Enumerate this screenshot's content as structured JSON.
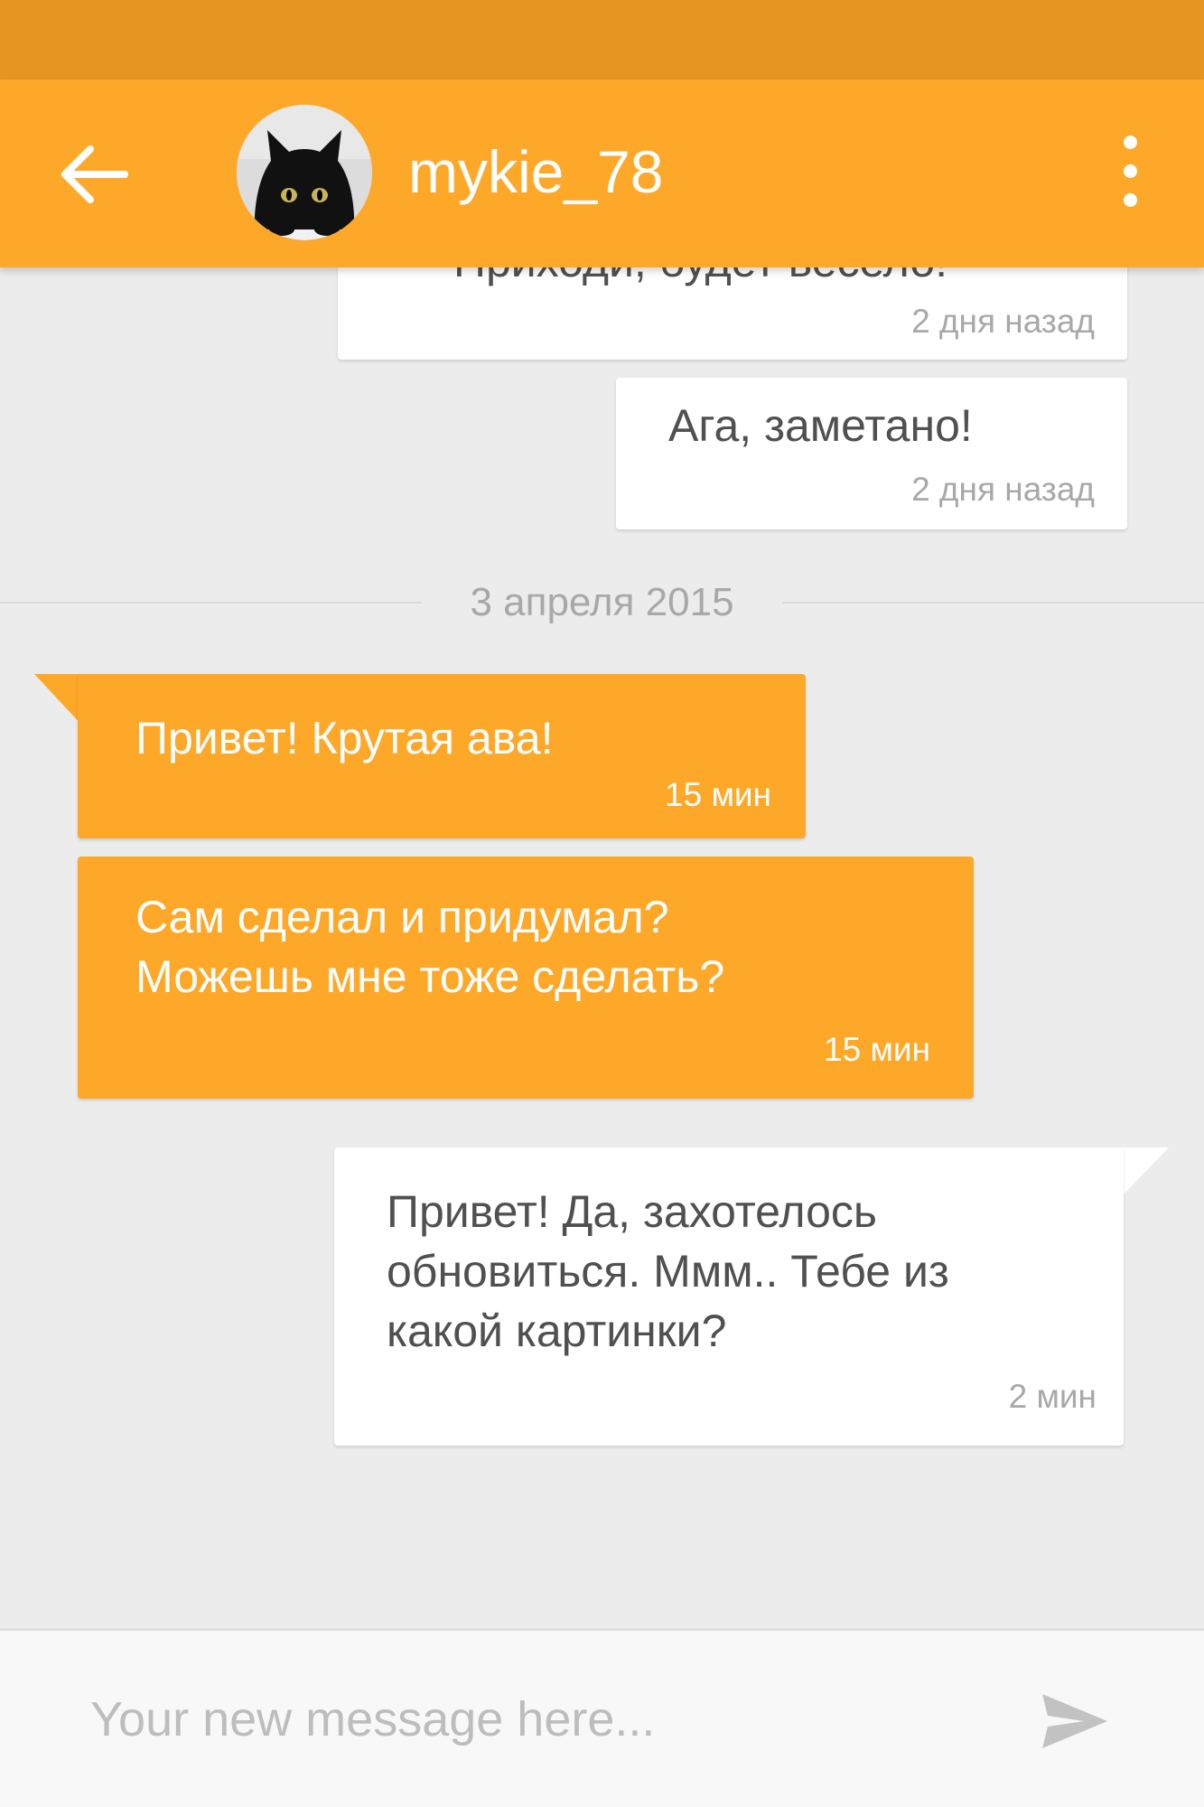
{
  "status_bar": {},
  "header": {
    "contact_name": "mykie_78",
    "back_icon": "arrow-left-icon",
    "menu_icon": "more-vert-icon",
    "colors": {
      "status_bar": "#e49522",
      "app_bar": "#fea82a"
    }
  },
  "messages": [
    {
      "direction": "outgoing",
      "text": "Приходи, будет весело!",
      "time": "2 дня назад",
      "partially_hidden": true
    },
    {
      "direction": "outgoing",
      "text": "Ага, заметано!",
      "time": "2 дня назад"
    },
    {
      "type": "date-divider",
      "label": "3 апреля 2015"
    },
    {
      "direction": "incoming",
      "text": "Привет! Крутая ава!",
      "time": "15 мин"
    },
    {
      "direction": "incoming",
      "text": "Сам сделал и придумал?\nМожешь мне тоже сделать?",
      "time": "15 мин"
    },
    {
      "direction": "outgoing",
      "text": "Привет! Да, захотелось\nобновиться. Ммм.. Тебе из\nкакой картинки?",
      "time": "2 мин"
    }
  ],
  "composer": {
    "placeholder": "Your new message here...",
    "value": "",
    "send_icon": "send-icon"
  },
  "colors": {
    "incoming_bubble": "#fea82a",
    "outgoing_bubble": "#ffffff",
    "chat_background": "#ececec"
  }
}
